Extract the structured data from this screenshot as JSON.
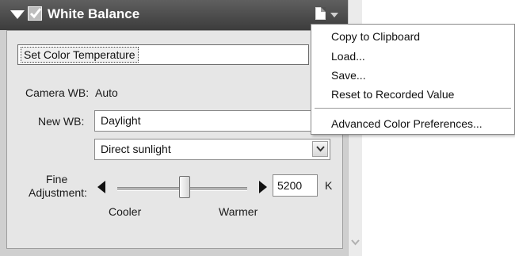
{
  "panel": {
    "title": "White Balance",
    "enabled": true
  },
  "mode": {
    "selected": "Set Color Temperature"
  },
  "camera_wb": {
    "label": "Camera WB:",
    "value": "Auto"
  },
  "new_wb": {
    "label": "New WB:",
    "value": "Daylight",
    "sub_value": "Direct sunlight"
  },
  "fine_adjustment": {
    "label_line1": "Fine",
    "label_line2": "Adjustment:",
    "value": "5200",
    "unit": "K",
    "left_label": "Cooler",
    "right_label": "Warmer",
    "slider_level": 0.52
  },
  "menu": {
    "items": [
      "Copy to Clipboard",
      "Load...",
      "Save...",
      "Reset to Recorded Value",
      "Advanced Color Preferences..."
    ]
  },
  "icons": {
    "collapse": "collapse-triangle-icon",
    "checkbox": "checkmark-icon",
    "document": "document-icon",
    "dropdown": "chevron-down-icon"
  }
}
